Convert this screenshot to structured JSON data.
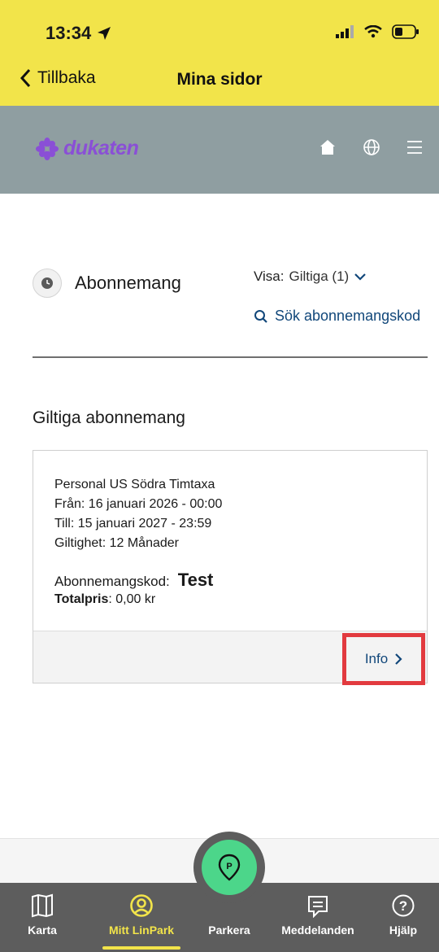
{
  "status": {
    "time": "13:34"
  },
  "nav": {
    "back_label": "Tillbaka",
    "title": "Mina sidor"
  },
  "brand": {
    "name": "dukaten",
    "color": "#8a4fd6"
  },
  "section": {
    "title": "Abonnemang",
    "filter_label": "Visa:",
    "filter_value": "Giltiga (1)",
    "search_label": "Sök abonnemangskod"
  },
  "list": {
    "heading": "Giltiga abonnemang",
    "items": [
      {
        "name": "Personal US Södra Timtaxa",
        "from_label": "Från",
        "from_value": ": 16 januari 2026 - 00:00",
        "to_label": "Till",
        "to_value": ": 15 januari 2027 - 23:59",
        "validity_label": "Giltighet",
        "validity_value": ": 12 Månader",
        "code_label": "Abonnemangskod:",
        "code_value": "Test",
        "price_label": "Totalpris",
        "price_value": ": 0,00 kr",
        "info_label": "Info"
      }
    ]
  },
  "tabs": [
    {
      "label": "Karta",
      "icon": "map-icon"
    },
    {
      "label": "Mitt LinPark",
      "icon": "user-circle-icon",
      "active": true
    },
    {
      "label": "Parkera",
      "icon": "parking-pin-icon"
    },
    {
      "label": "Meddelanden",
      "icon": "message-icon"
    },
    {
      "label": "Hjälp",
      "icon": "help-icon"
    }
  ],
  "colors": {
    "topbar": "#f2e44a",
    "header": "#8f9ea1",
    "link": "#11477a",
    "highlight": "#e23a3f",
    "park": "#4cd68a",
    "tabbar": "#5d5d5d"
  }
}
